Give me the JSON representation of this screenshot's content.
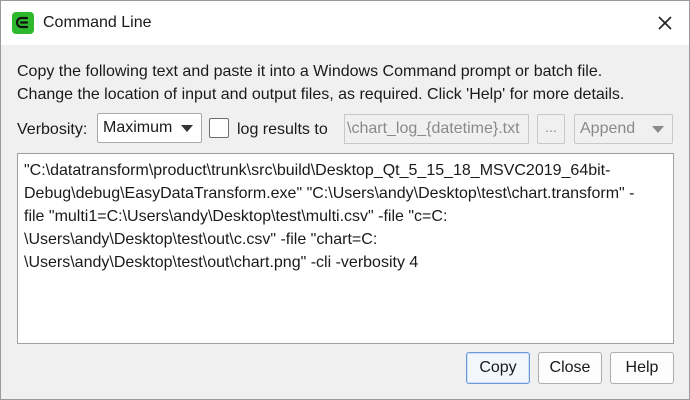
{
  "window": {
    "title": "Command Line",
    "icon": "app-logo-icon",
    "close_icon": "close-icon",
    "accent_color": "#2eb82e"
  },
  "instructions": {
    "line1": "Copy the following text and paste it into a Windows Command prompt or batch file.",
    "line2": "Change the location of input and output files, as required. Click 'Help' for more details."
  },
  "options": {
    "verbosity_label": "Verbosity:",
    "verbosity_value": "Maximum",
    "log_checked": false,
    "log_label": "log results to",
    "log_file": "\\chart_log_{datetime}.txt",
    "browse_label": "...",
    "mode_value": "Append"
  },
  "command": {
    "lines": [
      "\"C:\\datatransform\\product\\trunk\\src\\build\\Desktop_Qt_5_15_18_MSVC2019_64bit-",
      "Debug\\debug\\EasyDataTransform.exe\" \"C:\\Users\\andy\\Desktop\\test\\chart.transform\" -",
      "file \"multi1=C:\\Users\\andy\\Desktop\\test\\multi.csv\" -file \"c=C:",
      "\\Users\\andy\\Desktop\\test\\out\\c.csv\" -file \"chart=C:",
      "\\Users\\andy\\Desktop\\test\\out\\chart.png\" -cli -verbosity 4"
    ]
  },
  "buttons": {
    "copy": "Copy",
    "close": "Close",
    "help": "Help"
  }
}
